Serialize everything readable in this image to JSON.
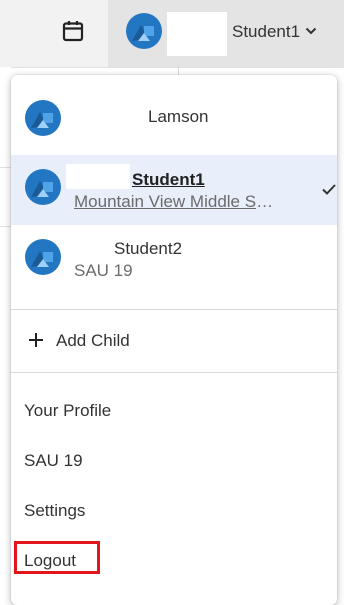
{
  "topbar": {
    "calendar_icon": "calendar-icon",
    "current_user": "Student1",
    "chevron_icon": "chevron-down-icon"
  },
  "accounts": [
    {
      "name": "Lamson",
      "subtitle": ""
    },
    {
      "name": "Student1",
      "subtitle": "Mountain View Middle School",
      "selected": true
    },
    {
      "name": "Student2",
      "subtitle": "SAU 19"
    }
  ],
  "menu": {
    "add_child": "Add Child",
    "your_profile": "Your Profile",
    "district": "SAU 19",
    "settings": "Settings",
    "logout": "Logout"
  },
  "colors": {
    "avatar": "#2377c2",
    "selected_row": "#e8effb",
    "highlight_box": "#e0161c"
  }
}
